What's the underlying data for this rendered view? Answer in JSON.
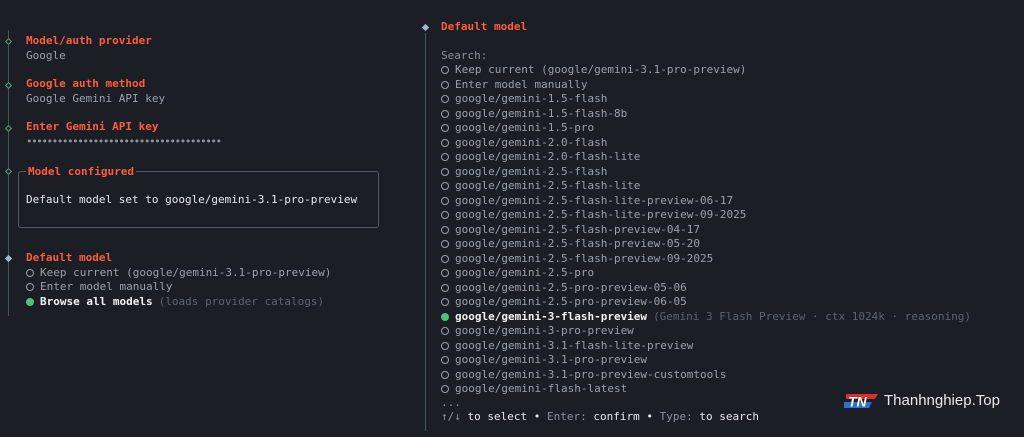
{
  "left": {
    "steps": [
      {
        "title": "Model/auth provider",
        "value": "Google"
      },
      {
        "title": "Google auth method",
        "value": "Google Gemini API key"
      },
      {
        "title": "Enter Gemini API key",
        "value": "••••••••••••••••••••••••••••••••••••••"
      }
    ],
    "configured": {
      "title": "Model configured",
      "body": "Default model set to google/gemini-3.1-pro-preview"
    },
    "default_model": {
      "title": "Default model",
      "options": [
        {
          "label": "Keep current (google/gemini-3.1-pro-preview)",
          "hint": "",
          "selected": false
        },
        {
          "label": "Enter model manually",
          "hint": "",
          "selected": false
        },
        {
          "label": "Browse all models",
          "hint": "(loads provider catalogs)",
          "selected": true
        }
      ]
    }
  },
  "right": {
    "title": "Default model",
    "search_label": "Search:",
    "options": [
      {
        "label": "Keep current (google/gemini-3.1-pro-preview)",
        "hint": "",
        "selected": false
      },
      {
        "label": "Enter model manually",
        "hint": "",
        "selected": false
      },
      {
        "label": "google/gemini-1.5-flash",
        "hint": "",
        "selected": false
      },
      {
        "label": "google/gemini-1.5-flash-8b",
        "hint": "",
        "selected": false
      },
      {
        "label": "google/gemini-1.5-pro",
        "hint": "",
        "selected": false
      },
      {
        "label": "google/gemini-2.0-flash",
        "hint": "",
        "selected": false
      },
      {
        "label": "google/gemini-2.0-flash-lite",
        "hint": "",
        "selected": false
      },
      {
        "label": "google/gemini-2.5-flash",
        "hint": "",
        "selected": false
      },
      {
        "label": "google/gemini-2.5-flash-lite",
        "hint": "",
        "selected": false
      },
      {
        "label": "google/gemini-2.5-flash-lite-preview-06-17",
        "hint": "",
        "selected": false
      },
      {
        "label": "google/gemini-2.5-flash-lite-preview-09-2025",
        "hint": "",
        "selected": false
      },
      {
        "label": "google/gemini-2.5-flash-preview-04-17",
        "hint": "",
        "selected": false
      },
      {
        "label": "google/gemini-2.5-flash-preview-05-20",
        "hint": "",
        "selected": false
      },
      {
        "label": "google/gemini-2.5-flash-preview-09-2025",
        "hint": "",
        "selected": false
      },
      {
        "label": "google/gemini-2.5-pro",
        "hint": "",
        "selected": false
      },
      {
        "label": "google/gemini-2.5-pro-preview-05-06",
        "hint": "",
        "selected": false
      },
      {
        "label": "google/gemini-2.5-pro-preview-06-05",
        "hint": "",
        "selected": false
      },
      {
        "label": "google/gemini-3-flash-preview",
        "hint": "(Gemini 3 Flash Preview · ctx 1024k · reasoning)",
        "selected": true
      },
      {
        "label": "google/gemini-3-pro-preview",
        "hint": "",
        "selected": false
      },
      {
        "label": "google/gemini-3.1-flash-lite-preview",
        "hint": "",
        "selected": false
      },
      {
        "label": "google/gemini-3.1-pro-preview",
        "hint": "",
        "selected": false
      },
      {
        "label": "google/gemini-3.1-pro-preview-customtools",
        "hint": "",
        "selected": false
      },
      {
        "label": "google/gemini-flash-latest",
        "hint": "",
        "selected": false
      }
    ],
    "more": "...",
    "footer": {
      "arrows": "↑/↓",
      "select": "to select",
      "sep": "•",
      "enter": "Enter:",
      "confirm": "confirm",
      "type": "Type:",
      "search": "to search"
    }
  },
  "watermark": {
    "logo_text": "TN",
    "text": "Thanhnghiep.Top"
  },
  "colors": {
    "background": "#1b1e25",
    "accent": "#ff5c3b",
    "selected_dot": "#4fc27a",
    "rail": "#3c5a4e"
  }
}
